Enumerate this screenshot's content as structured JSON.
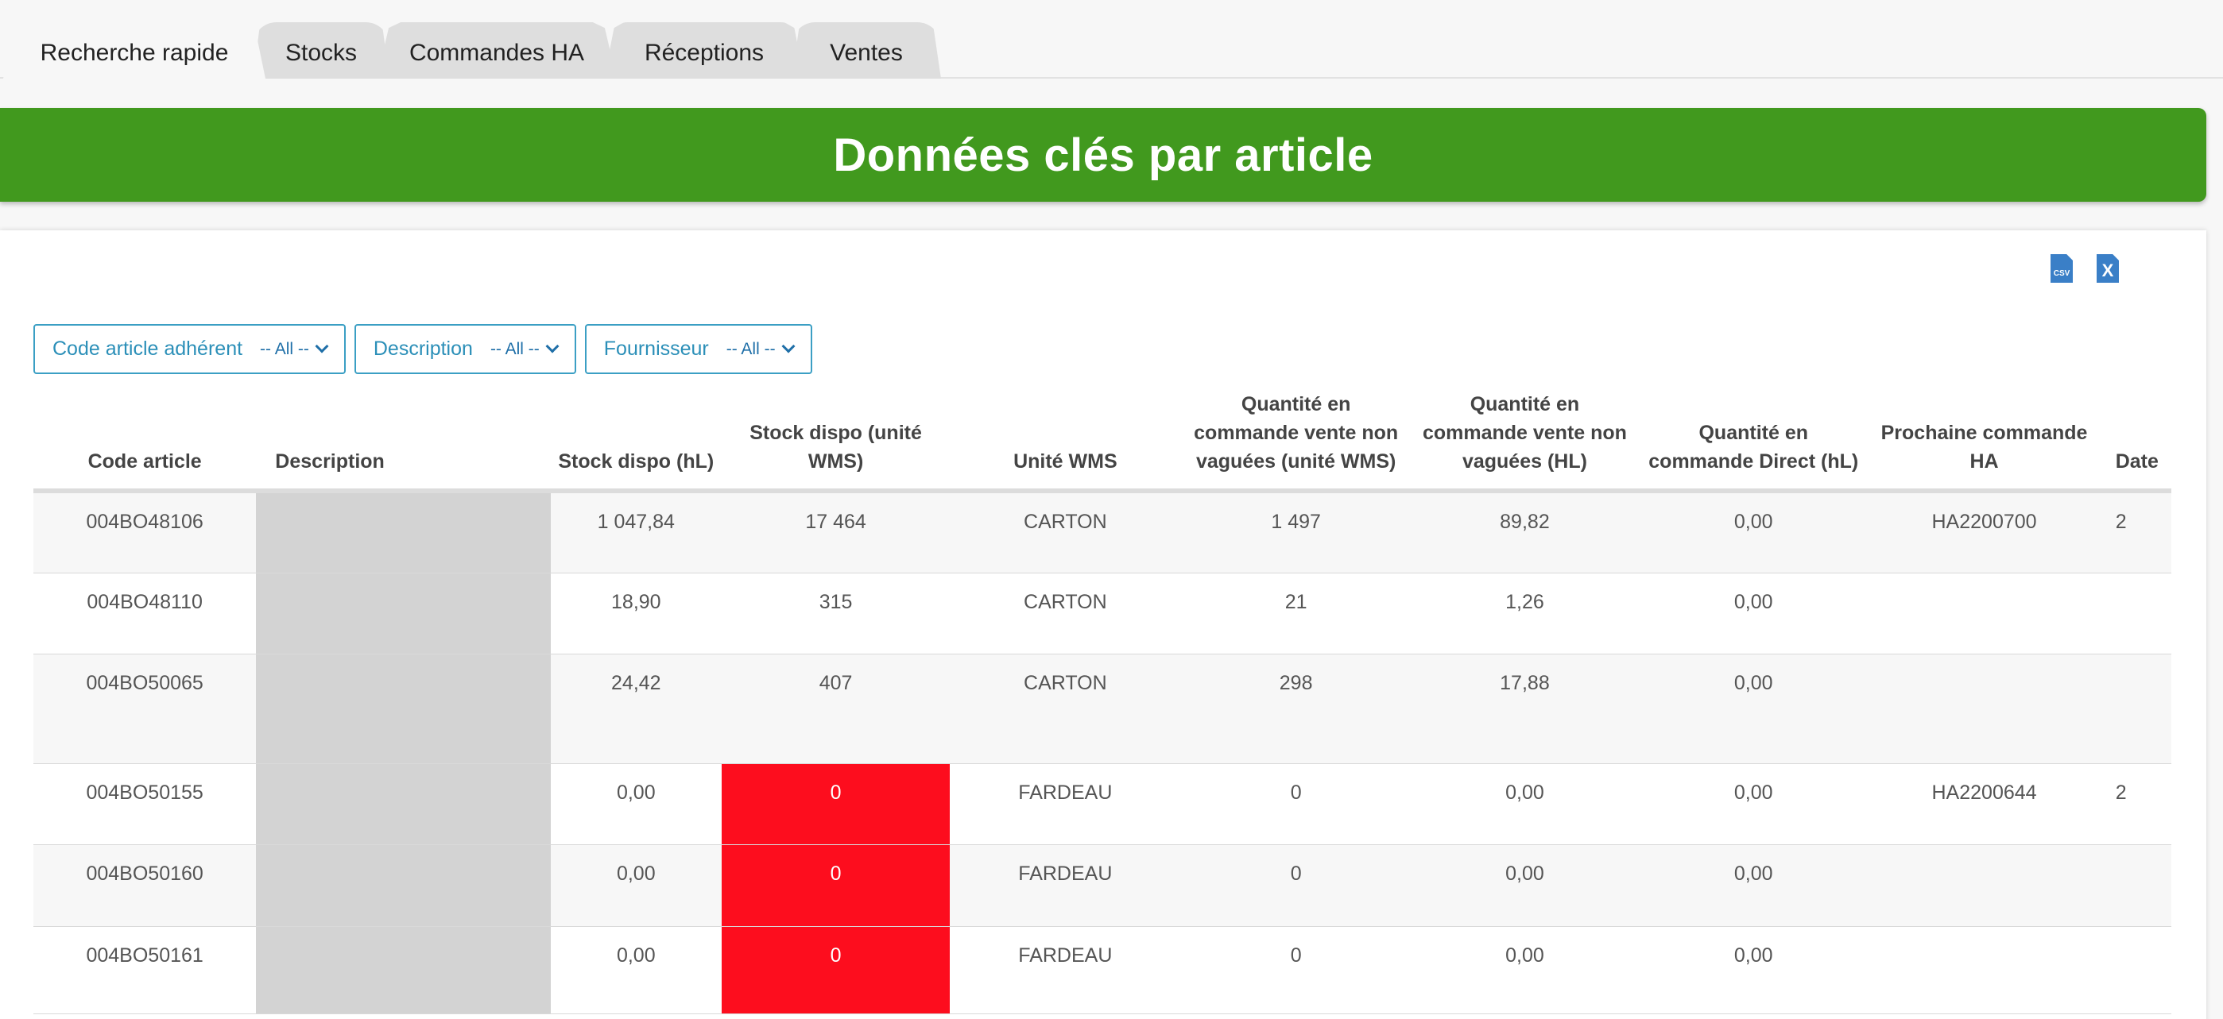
{
  "tabs": [
    {
      "label": "Recherche rapide",
      "active": true
    },
    {
      "label": "Stocks",
      "active": false
    },
    {
      "label": "Commandes HA",
      "active": false
    },
    {
      "label": "Réceptions",
      "active": false
    },
    {
      "label": "Ventes",
      "active": false
    }
  ],
  "banner": {
    "title": "Données clés par article"
  },
  "exports": {
    "csv_label": "CSV",
    "xls_label": "X"
  },
  "filters": [
    {
      "label": "Code article adhérent",
      "value": "-- All --"
    },
    {
      "label": "Description",
      "value": "-- All --"
    },
    {
      "label": "Fournisseur",
      "value": "-- All --"
    }
  ],
  "table": {
    "columns": [
      "Code article",
      "Description",
      "Stock dispo (hL)",
      "Stock dispo (unité WMS)",
      "Unité WMS",
      "Quantité en commande vente non vaguées (unité WMS)",
      "Quantité en commande vente non vaguées (HL)",
      "Quantité en commande Direct (hL)",
      "Prochaine commande HA",
      "Date"
    ],
    "rows": [
      {
        "code": "004BO48106",
        "stock_hl": "1 047,84",
        "stock_wms": "17 464",
        "unit": "CARTON",
        "qty_wms": "1 497",
        "qty_hl": "89,82",
        "qty_direct": "0,00",
        "next_ha": "HA2200700",
        "date": "2",
        "alert": false
      },
      {
        "code": "004BO48110",
        "stock_hl": "18,90",
        "stock_wms": "315",
        "unit": "CARTON",
        "qty_wms": "21",
        "qty_hl": "1,26",
        "qty_direct": "0,00",
        "next_ha": "",
        "date": "",
        "alert": false
      },
      {
        "code": "004BO50065",
        "stock_hl": "24,42",
        "stock_wms": "407",
        "unit": "CARTON",
        "qty_wms": "298",
        "qty_hl": "17,88",
        "qty_direct": "0,00",
        "next_ha": "",
        "date": "",
        "alert": false
      },
      {
        "code": "004BO50155",
        "stock_hl": "0,00",
        "stock_wms": "0",
        "unit": "FARDEAU",
        "qty_wms": "0",
        "qty_hl": "0,00",
        "qty_direct": "0,00",
        "next_ha": "HA2200644",
        "date": "2",
        "alert": true
      },
      {
        "code": "004BO50160",
        "stock_hl": "0,00",
        "stock_wms": "0",
        "unit": "FARDEAU",
        "qty_wms": "0",
        "qty_hl": "0,00",
        "qty_direct": "0,00",
        "next_ha": "",
        "date": "",
        "alert": true
      },
      {
        "code": "004BO50161",
        "stock_hl": "0,00",
        "stock_wms": "0",
        "unit": "FARDEAU",
        "qty_wms": "0",
        "qty_hl": "0,00",
        "qty_direct": "0,00",
        "next_ha": "",
        "date": "",
        "alert": true
      }
    ]
  },
  "colors": {
    "banner_green": "#41991e",
    "alert_red": "#fd0d1e",
    "filter_blue": "#3b9fc4",
    "export_blue": "#3a7fc7"
  }
}
